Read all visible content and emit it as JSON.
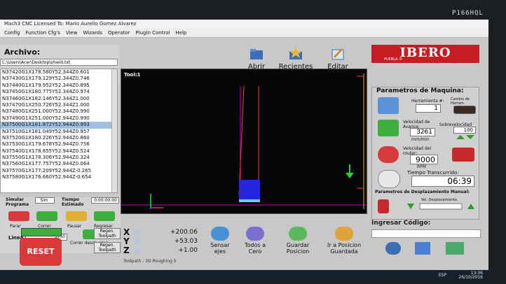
{
  "monitor_brand": "P166HQL",
  "window": {
    "title": "Mach3 CNC  Licensed To: Mario Aurelio Gomez Alvarez"
  },
  "menu": [
    "Config",
    "Function Cfg's",
    "View",
    "Wizards",
    "Operator",
    "PlugIn Control",
    "Help"
  ],
  "file": {
    "title": "Archivo:",
    "path": "C:\\Users\\Acer\\Desktop\\shield.txt",
    "buttons": [
      {
        "label": "Abrir"
      },
      {
        "label": "Recientes"
      },
      {
        "label": "Editar"
      }
    ]
  },
  "logo": {
    "main": "IBERO",
    "sub": "PUEBLA ®"
  },
  "gcode": {
    "lines": [
      "N37420G1X178.580Y52.344Z0.601",
      "N37430G1X179.129Y52.344Z0.746",
      "N37440G1X179.952Y52.344Z0.895",
      "N37450G1X180.775Y52.344Z0.974",
      "N37460G1X182.146Y52.344Z1.000",
      "N37470G1X250.726Y52.344Z1.000",
      "N37480G1X251.000Y52.344Z0.990",
      "N37490G1X251.000Y52.944Z0.990",
      "N37500G1X181.872Y52.944Z0.993",
      "N37510G1X181.049Y52.944Z0.957",
      "N37520G1X180.226Y52.944Z0.860",
      "N37530G1X179.678Y52.944Z0.756",
      "N37540G1X178.855Y52.944Z0.524",
      "N37550G1X178.306Y52.944Z0.324",
      "N37560G1X177.757Y52.944Z0.064",
      "N37570G1X177.209Y52.944Z-0.265",
      "N37580G1X176.660Y52.944Z-0.654"
    ],
    "selected_index": 8
  },
  "viewport": {
    "tool_label": "Tool:1",
    "toolpath_label": "Toolpath - 3D Roughing 5"
  },
  "sim": {
    "simular_label": "Simular Programa",
    "sim_value": "Sim",
    "tiempo_label": "Tiempo Estimado",
    "tiempo_value": "0:00:00:00"
  },
  "run_controls": {
    "parar": "Parar",
    "correr": "Correr",
    "pausar": "Pausar",
    "regresar": "Regresar",
    "linea_label": "Linea",
    "linea_value": "3750",
    "correr_desde": "Correr desde aqui"
  },
  "reset_label": "RESET",
  "dro": {
    "x": {
      "axis": "X",
      "value": "+200.06"
    },
    "y": {
      "axis": "Y",
      "value": "+53.03"
    },
    "z": {
      "axis": "Z",
      "value": "+1.00"
    }
  },
  "regen": [
    "Regen. Toolpath",
    "Regen. Toolpath"
  ],
  "actions": [
    {
      "label": "Sensar ejes"
    },
    {
      "label": "Todos a Cero"
    },
    {
      "label": "Guardar Posicion"
    },
    {
      "label": "Ir a Posicion Guardada"
    }
  ],
  "machine_params": {
    "title": "Parametros de Maquina:",
    "herramienta_label": "Herramienta #:",
    "herramienta_value": "1",
    "cambio_label": "Cambio de Herram.",
    "velocidad_avance_label": "Velocidad de Avance:",
    "velocidad_avance_value": "3261",
    "unidad_avance": "mm/min",
    "sobrevelocidad_label": "Sobrevelocidad",
    "sobrevelocidad_value": "100",
    "velocidad_router_label": "Velocidad del router:",
    "velocidad_router_value": "9000",
    "rpm": "RPM",
    "tiempo_trans_label": "Tiempo Transcurrido:",
    "tiempo_trans_value": "06:39",
    "desplazamiento_label": "Parametros de Desplazamiento Manual:",
    "velocidad_desp_label": "Vel. Desplazamiento"
  },
  "ingresar": {
    "label": "Ingresar Código:"
  },
  "taskbar": {
    "lang": "ESP",
    "time": "13:36",
    "date": "26/10/2016"
  },
  "colors": {
    "accent": "#c51d23",
    "viewport": "#050608",
    "magenta": "#c000c0"
  }
}
